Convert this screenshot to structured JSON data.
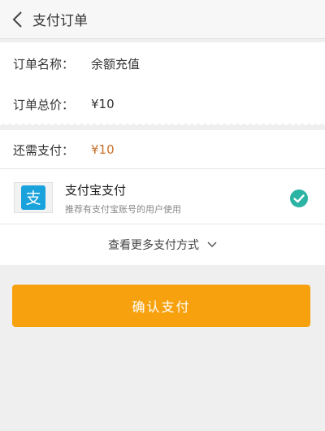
{
  "header": {
    "title": "支付订单",
    "back_icon": "chevron-left-icon"
  },
  "order": {
    "name_label": "订单名称：",
    "name_value": "余额充值",
    "total_label": "订单总价：",
    "total_value": "¥10"
  },
  "payment_due": {
    "label": "还需支付：",
    "value": "¥10",
    "value_color": "#c8702a"
  },
  "alipay": {
    "logo_glyph": "支",
    "logo_color": "#1aa2dc",
    "title": "支付宝支付",
    "subtitle": "推荐有支付宝账号的用户使用",
    "selected": true,
    "check_color": "#2bb3a4"
  },
  "more_methods": {
    "label": "查看更多支付方式",
    "icon": "chevron-down-icon"
  },
  "confirm_button": {
    "label": "确认支付",
    "color": "#f7a10e"
  }
}
